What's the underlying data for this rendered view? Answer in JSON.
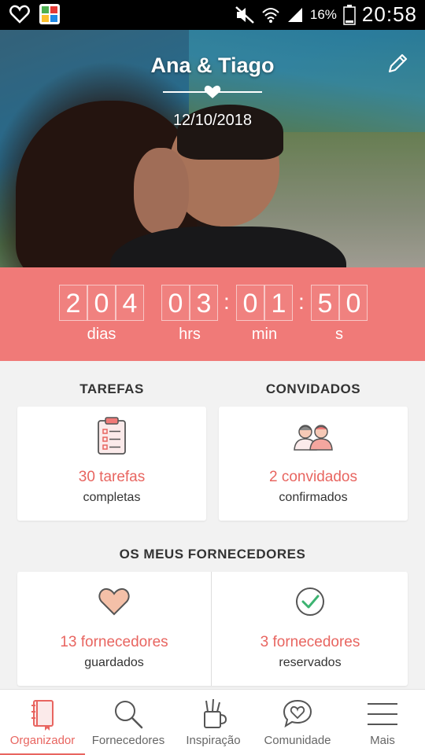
{
  "status_bar": {
    "battery_percent": "16%",
    "time": "20:58",
    "icons": [
      "heart-outline-icon",
      "app-grid-icon",
      "mute-icon",
      "wifi-icon",
      "signal-icon",
      "battery-icon"
    ]
  },
  "hero": {
    "couple_name": "Ana & Tiago",
    "wedding_date": "12/10/2018",
    "edit_icon": "pencil-icon"
  },
  "countdown": {
    "days_digits": [
      "2",
      "0",
      "4"
    ],
    "hours_digits": [
      "0",
      "3"
    ],
    "minutes_digits": [
      "0",
      "1"
    ],
    "seconds_digits": [
      "5",
      "0"
    ],
    "labels": {
      "days": "dias",
      "hours": "hrs",
      "minutes": "min",
      "seconds": "s"
    },
    "separator": ":"
  },
  "tasks": {
    "title": "TAREFAS",
    "count_label": "30 tarefas",
    "sub_label": "completas",
    "icon": "clipboard-checklist-icon"
  },
  "guests": {
    "title": "CONVIDADOS",
    "count_label": "2 convidados",
    "sub_label": "confirmados",
    "icon": "guests-icon"
  },
  "vendors": {
    "title": "OS MEUS FORNECEDORES",
    "saved": {
      "count_label": "13 fornecedores",
      "sub_label": "guardados",
      "icon": "heart-icon"
    },
    "booked": {
      "count_label": "3 fornecedores",
      "sub_label": "reservados",
      "icon": "check-circle-icon"
    }
  },
  "bottom_nav": {
    "items": [
      {
        "label": "Organizador",
        "icon": "notebook-icon",
        "active": true
      },
      {
        "label": "Fornecedores",
        "icon": "search-icon",
        "active": false
      },
      {
        "label": "Inspiração",
        "icon": "pencil-cup-icon",
        "active": false
      },
      {
        "label": "Comunidade",
        "icon": "chat-heart-icon",
        "active": false
      },
      {
        "label": "Mais",
        "icon": "menu-icon",
        "active": false
      }
    ]
  },
  "colors": {
    "accent": "#e86560",
    "countdown_bg": "#f07a78",
    "page_bg": "#f2f2f2"
  }
}
